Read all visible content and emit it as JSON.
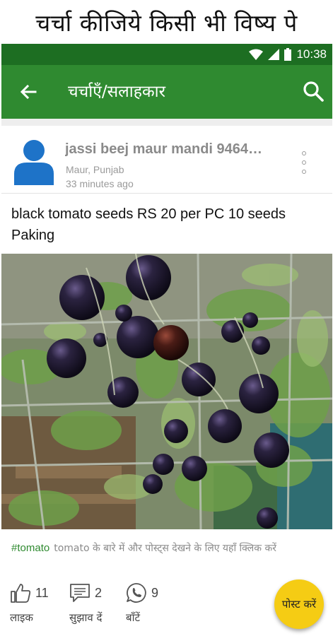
{
  "banner": {
    "text": "चर्चा कीजिये किसी भी विष्य पे"
  },
  "status_bar": {
    "time": "10:38",
    "icons": [
      "wifi-icon",
      "signal-icon",
      "battery-icon"
    ]
  },
  "app_bar": {
    "title": "चर्चाएँ/सलाहकार",
    "icons": [
      "back-arrow-icon",
      "search-icon"
    ]
  },
  "post": {
    "author_name": "jassi beej maur mandi 9464…",
    "location": "Maur, Punjab",
    "time_ago": "33 minutes ago",
    "text": "black tomato seeds RS 20 per PC 10 seeds Paking",
    "hashtag": "#tomato",
    "hashtag_hint": "tomato के बारे में और पोस्ट्स देखने के लिए यहाँ क्लिक करें"
  },
  "actions": {
    "like": {
      "count": "11",
      "label": "लाइक"
    },
    "suggest": {
      "count": "2",
      "label": "सुझाव दें"
    },
    "share": {
      "count": "9",
      "label": "बाँटें"
    }
  },
  "fab": {
    "label": "पोस्ट करें"
  },
  "colors": {
    "status_bar": "#1d6e22",
    "app_bar": "#2f8a30",
    "accent_fab": "#f5cc14",
    "hashtag": "#2f8a30"
  }
}
